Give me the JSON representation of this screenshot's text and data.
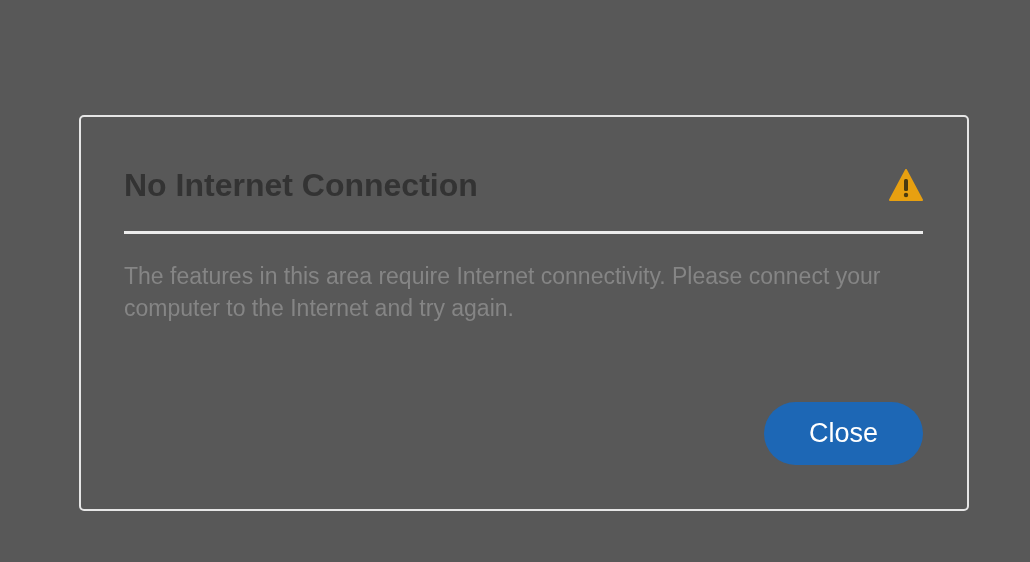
{
  "dialog": {
    "title": "No Internet Connection",
    "message": "The features in this area require Internet connectivity. Please connect your computer to the Internet and try again.",
    "buttons": [
      "Close"
    ]
  }
}
